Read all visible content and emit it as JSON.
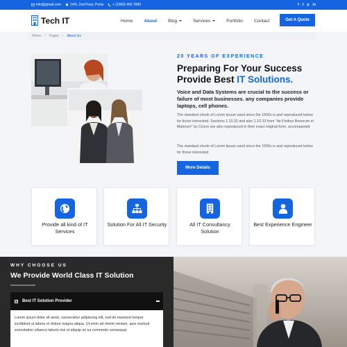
{
  "topbar": {
    "email": "info@gmail.com",
    "address": "14/5, 2nd Floor, Porta",
    "phone": "+ (1000) 456 7890",
    "social": [
      "f",
      "t",
      "p",
      "in"
    ]
  },
  "brand": {
    "name": "Tech IT",
    "accent": "#1565e0"
  },
  "nav": {
    "items": [
      {
        "label": "Home"
      },
      {
        "label": "About"
      },
      {
        "label": "Blog"
      },
      {
        "label": "Services"
      },
      {
        "label": "Portfolio"
      },
      {
        "label": "Contact"
      }
    ],
    "active": "About",
    "cta": "Get A Quote"
  },
  "breadcrumb": [
    "Home",
    "Pages",
    "About Us"
  ],
  "about": {
    "kicker": "20 YEARS OF EXPERIENCE",
    "title_1": "Preparing For Your Success",
    "title_2": "Provide Best ",
    "title_highlight": "IT Solutions.",
    "lead": "Voice and Data Systems are crucial to the success or failure of most businesses. any companies provide laptops, cell phones.",
    "para_1": "The standard chunk of Lorem Ipsum used since the 1500s is and reproduced below for those interested. Sections 1.10.32 and also 1.10.33 from \"de Finibus Bonorum et Malorum\" by Cicero are also reproduced in their exact original form, accompanied",
    "para_2": "The standard chunk of Lorem Ipsum used since the 1500s is and reproduced below for those interested",
    "button": "More Details"
  },
  "features": [
    {
      "label": "Provide all kind of IT Services",
      "icon": "globe-icon"
    },
    {
      "label": "Solution For All IT Security",
      "icon": "network-icon"
    },
    {
      "label": "All IT Consultancy Solution",
      "icon": "building-icon"
    },
    {
      "label": "Best Experience Engineer",
      "icon": "user-icon"
    }
  ],
  "why": {
    "kicker": "WHY CHOOSE US",
    "title": "We Provide World Class IT Solution",
    "accordion_title": "Best IT Solution Provider",
    "accordion_body": "Lorem ipsum dolor sit amet, consectetur adipiscing elit, sed do eiusmod tempor incididunt ut labore et dolore magna aliqua. Ut enim ad minim veniam, quis nostrud exercitation ullamco laboris nisi ut aliquip ex ea commodo consequat."
  }
}
